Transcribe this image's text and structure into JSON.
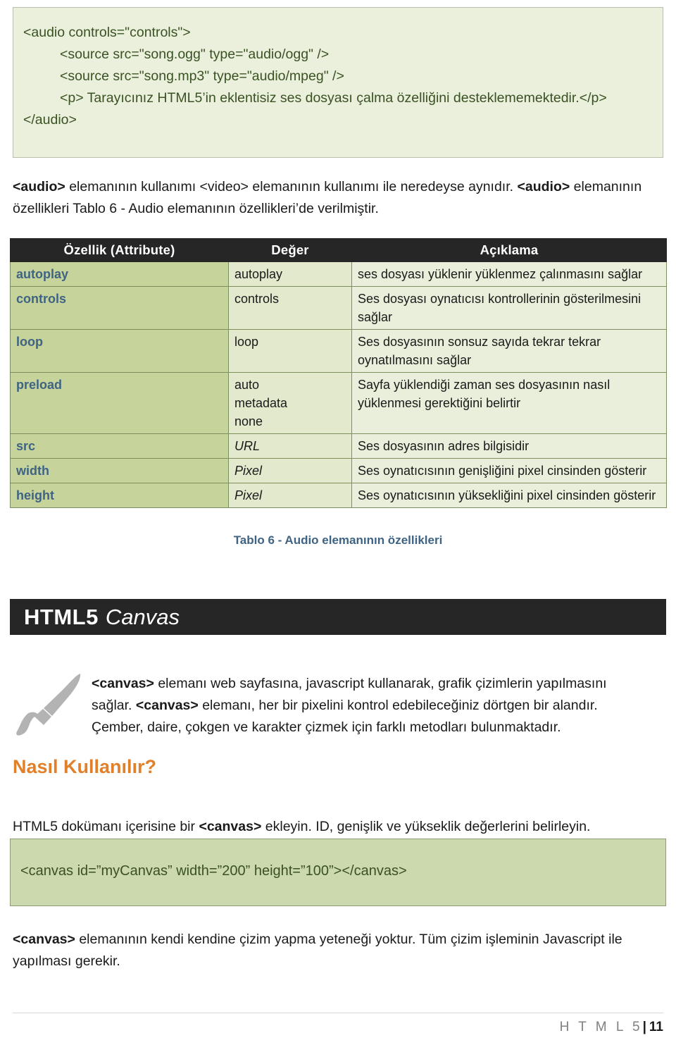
{
  "code_top": {
    "lines": [
      {
        "text": "<audio controls=\"controls\">",
        "indent": 0
      },
      {
        "text": "<source src=\"song.ogg\" type=\"audio/ogg\" />",
        "indent": 1
      },
      {
        "text": "<source src=\"song.mp3\" type=\"audio/mpeg\" />",
        "indent": 1
      },
      {
        "text": "<p> Tarayıcınız HTML5’in eklentisiz ses dosyası çalma özelliğini desteklememektedir.</p>",
        "indent": 1
      },
      {
        "text": "</audio>",
        "indent": 0
      }
    ]
  },
  "audio_intro": {
    "part1_bold": "<audio>",
    "part2": " elemanının kullanımı <video> elemanının kullanımı ile neredeyse aynıdır. ",
    "part3_bold": "<audio>",
    "part4": " elemanının özellikleri Tablo 6 - Audio  elemanının özellikleri’de verilmiştir."
  },
  "table": {
    "headers": [
      "Özellik (Attribute)",
      "Değer",
      "Açıklama"
    ],
    "rows": [
      {
        "attribute": "autoplay",
        "values": [
          "autoplay"
        ],
        "value_italic": false,
        "description": "ses dosyası yüklenir yüklenmez çalınmasını sağlar"
      },
      {
        "attribute": "controls",
        "values": [
          "controls"
        ],
        "value_italic": false,
        "description": "Ses dosyası oynatıcısı kontrollerinin gösterilmesini sağlar"
      },
      {
        "attribute": "loop",
        "values": [
          "loop"
        ],
        "value_italic": false,
        "description": "Ses dosyasının sonsuz sayıda tekrar tekrar oynatılmasını sağlar"
      },
      {
        "attribute": "preload",
        "values": [
          "auto",
          "metadata",
          "none"
        ],
        "value_italic": false,
        "description": "Sayfa yüklendiği zaman ses dosyasının nasıl yüklenmesi gerektiğini belirtir"
      },
      {
        "attribute": "src",
        "values": [
          "URL"
        ],
        "value_italic": true,
        "description": "Ses dosyasının adres bilgisidir"
      },
      {
        "attribute": "width",
        "values": [
          "Pixel"
        ],
        "value_italic": true,
        "description": "Ses oynatıcısının  genişliğini pixel cinsinden gösterir"
      },
      {
        "attribute": "height",
        "values": [
          "Pixel"
        ],
        "value_italic": true,
        "description": "Ses oynatıcısının yüksekliğini pixel cinsinden gösterir"
      }
    ],
    "caption": "Tablo 6 - Audio  elemanının özellikleri"
  },
  "banner": {
    "title_bold": "HTML5",
    "title_italic": "Canvas"
  },
  "canvas_desc": {
    "b1": "<canvas>",
    "t1": " elemanı web sayfasına,  javascript kullanarak, grafik çizimlerin yapılmasını sağlar. ",
    "b2": "<canvas>",
    "t2": " elemanı, her bir pixelini kontrol edebileceğiniz dörtgen bir alandır. Çember, daire, çokgen ve karakter çizmek için farklı metodları bulunmaktadır."
  },
  "how_to_heading": "Nasıl Kullanılır?",
  "ekleyin": {
    "t1": "HTML5 dokümanı içerisine bir ",
    "b1": "<canvas>",
    "t2": " ekleyin. ID, genişlik ve yükseklik değerlerini belirleyin."
  },
  "code_bottom": {
    "line": "<canvas id=”myCanvas” width=”200” height=”100”></canvas>"
  },
  "canvas_end": {
    "b1": "<canvas>",
    "t1": " elemanının kendi kendine çizim yapma yeteneği yoktur. Tüm çizim işleminin Javascript ile yapılması gerekir."
  },
  "footer": {
    "doc_label": "H T M L 5",
    "separator": "|",
    "page_number": "11"
  },
  "colors": {
    "code_top_bg": "#eaf0db",
    "code_bottom_bg": "#ccd8ad",
    "code_text": "#3a5223",
    "table_header_bg": "#262626",
    "table_attr_bg": "#c6d49b",
    "table_value_bg": "#e2e9cd",
    "table_desc_bg": "#e9efdb",
    "attr_text": "#3f6383",
    "caption_text": "#3f6383",
    "banner_bg": "#262626",
    "heading_orange": "#e0802b",
    "brush_gray": "#b3b3b3"
  }
}
